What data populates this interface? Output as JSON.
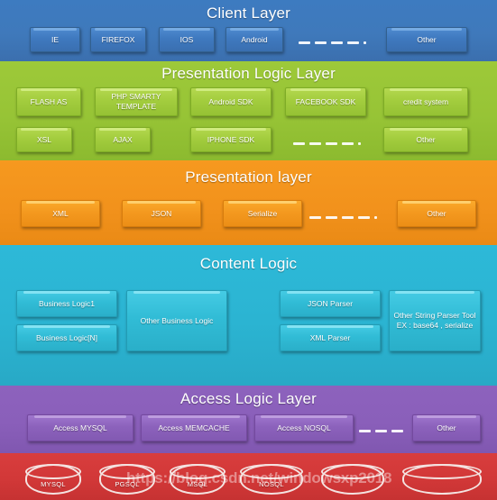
{
  "layers": [
    {
      "id": "client",
      "title": "Client Layer",
      "color": "#3f79bb",
      "items": [
        "IE",
        "FIREFOX",
        "IOS",
        "Android",
        "Other"
      ]
    },
    {
      "id": "presentation-logic",
      "title": "Presentation Logic Layer",
      "color": "#97c436",
      "row1": [
        "FLASH AS",
        "PHP SMARTY TEMPLATE",
        "Android SDK",
        "FACEBOOK SDK",
        "credit system"
      ],
      "row2": [
        "XSL",
        "AJAX",
        "IPHONE SDK",
        "Other"
      ]
    },
    {
      "id": "presentation",
      "title": "Presentation layer",
      "color": "#f2921c",
      "items": [
        "XML",
        "JSON",
        "Serialize",
        "Other"
      ]
    },
    {
      "id": "content-logic",
      "title": "Content Logic",
      "color": "#2bb4d2",
      "items": [
        "Business Logic1",
        "Business Logic[N]",
        "Other Business Logic",
        "JSON Parser",
        "XML Parser",
        "Other String Parser Tool EX : base64 , serialize"
      ]
    },
    {
      "id": "access-logic",
      "title": "Access Logic Layer",
      "color": "#8a5fba",
      "items": [
        "Access MYSQL",
        "Access MEMCACHE",
        "Access NOSQL",
        "Other"
      ]
    },
    {
      "id": "database",
      "title": "",
      "color": "#d23838",
      "items": [
        "MYSQL",
        "PGSQL",
        "MSQL",
        "NOSQL",
        "",
        ""
      ]
    }
  ],
  "client": {
    "title": "Client Layer",
    "ie": "IE",
    "firefox": "FIREFOX",
    "ios": "IOS",
    "android": "Android",
    "other": "Other"
  },
  "presentation_logic": {
    "title": "Presentation Logic Layer",
    "flash_as": "FLASH AS",
    "php_smarty_template": "PHP SMARTY TEMPLATE",
    "android_sdk": "Android SDK",
    "facebook_sdk": "FACEBOOK SDK",
    "credit_system": "credit system",
    "xsl": "XSL",
    "ajax": "AJAX",
    "iphone_sdk": "IPHONE SDK",
    "other": "Other"
  },
  "presentation": {
    "title": "Presentation layer",
    "xml": "XML",
    "json": "JSON",
    "serialize": "Serialize",
    "other": "Other"
  },
  "content_logic": {
    "title": "Content Logic",
    "business_logic_1": "Business Logic1",
    "business_logic_n": "Business Logic[N]",
    "other_business_logic": "Other Business Logic",
    "json_parser": "JSON Parser",
    "xml_parser": "XML Parser",
    "other_string_parser": "Other String Parser Tool EX : base64 , serialize"
  },
  "access_logic": {
    "title": "Access Logic Layer",
    "access_mysql": "Access MYSQL",
    "access_memcache": "Access  MEMCACHE",
    "access_nosql": "Access  NOSQL",
    "other": "Other"
  },
  "database": {
    "mysql": "MYSQL",
    "pgsql": "PGSQL",
    "msql": "MSQL",
    "nosql": "NOSQL",
    "db5": "",
    "db6": ""
  },
  "watermark": {
    "text": "https://blog.csdn.net/windowsxp2018"
  }
}
